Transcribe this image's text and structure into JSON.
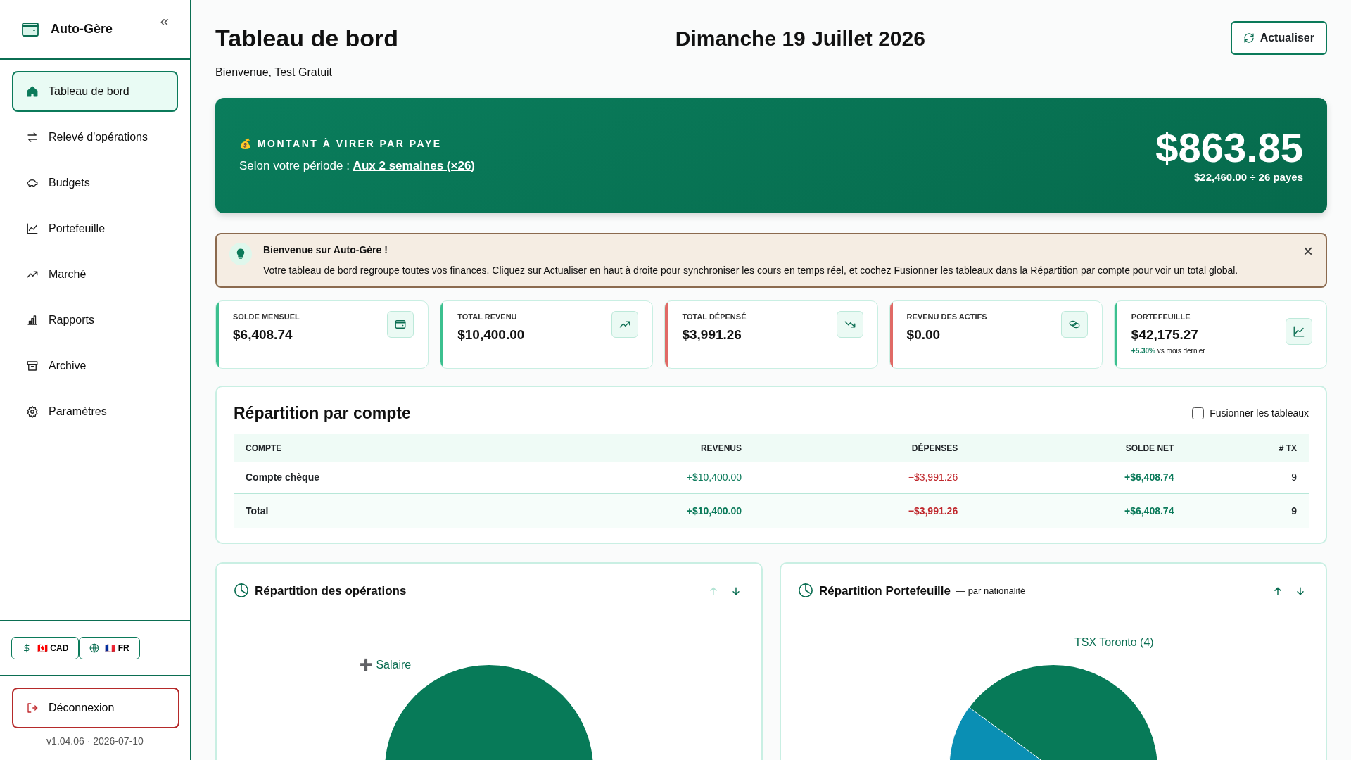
{
  "sidebar": {
    "brand": "Auto-Gère",
    "collapse": "«",
    "items": [
      {
        "label": "Tableau de bord",
        "kind": "home",
        "selected": true
      },
      {
        "label": "Relevé d'opérations",
        "kind": "swap",
        "selected": false
      },
      {
        "label": "Budgets",
        "kind": "piggy",
        "selected": false
      },
      {
        "label": "Portefeuille",
        "kind": "line",
        "selected": false
      },
      {
        "label": "Marché",
        "kind": "trend",
        "selected": false
      },
      {
        "label": "Rapports",
        "kind": "bars",
        "selected": false
      },
      {
        "label": "Archive",
        "kind": "archive",
        "selected": false
      },
      {
        "label": "Paramètres",
        "kind": "gear",
        "selected": false
      }
    ],
    "toggles": [
      {
        "kind": "currency",
        "flag": "🇨🇦",
        "label": "CAD"
      },
      {
        "kind": "language",
        "flag": "🇫🇷",
        "label": "FR"
      }
    ],
    "logout": "Déconnexion",
    "version": "v1.04.06 · 2026-07-10"
  },
  "header": {
    "title": "Tableau de bord",
    "subtitle": "Bienvenue, Test Gratuit",
    "date": "Dimanche 19 Juillet 2026",
    "refresh": "Actualiser"
  },
  "banner": {
    "emoji": "💰",
    "label": "MONTANT À VIRER PAR PAYE",
    "period_prefix": "Selon votre période :",
    "period": "Aux 2 semaines (×26)",
    "amount": "$863.85",
    "detail": "$22,460.00 ÷ 26 payes"
  },
  "alert": {
    "title": "Bienvenue sur Auto-Gère !",
    "text": "Votre tableau de bord regroupe toutes vos finances. Cliquez sur Actualiser en haut à droite pour synchroniser les cours en temps réel, et cochez Fusionner les tableaux dans la Répartition par compte pour voir un total global.",
    "close": "×"
  },
  "stats": [
    {
      "label": "SOLDE MENSUEL",
      "value": "$6,408.74",
      "kind": "wallet",
      "color": "#3cc08f"
    },
    {
      "label": "TOTAL REVENU",
      "value": "$10,400.00",
      "kind": "trend-up",
      "color": "#3cc08f"
    },
    {
      "label": "TOTAL DÉPENSÉ",
      "value": "$3,991.26",
      "kind": "trend-down",
      "color": "#e06a66"
    },
    {
      "label": "REVENU DES ACTIFS",
      "value": "$0.00",
      "kind": "coins",
      "color": "#e06a66"
    },
    {
      "label": "PORTEFEUILLE",
      "value": "$42,175.27",
      "kind": "chart",
      "color": "#3cc08f",
      "change": "+5.30%",
      "change_note": "vs mois dernier"
    }
  ],
  "accounts": {
    "title": "Répartition par compte",
    "merge": {
      "label": "Fusionner les tableaux",
      "checked": false
    },
    "columns": [
      {
        "label": "COMPTE",
        "kind": "plain"
      },
      {
        "label": "REVENUS",
        "kind": "positive"
      },
      {
        "label": "DÉPENSES",
        "kind": "negative"
      },
      {
        "label": "SOLDE NET",
        "kind": "positive"
      },
      {
        "label": "# TX",
        "kind": "plain"
      }
    ],
    "rows": [
      {
        "kind": "row",
        "cells": [
          "Compte chèque",
          "+$10,400.00",
          "−$3,991.26",
          "+$6,408.74",
          "9"
        ]
      },
      {
        "kind": "total",
        "cells": [
          "Total",
          "+$10,400.00",
          "−$3,991.26",
          "+$6,408.74",
          "9"
        ]
      }
    ]
  },
  "charts": [
    {
      "title": "Répartition des opérations",
      "up": {
        "disabled": true
      },
      "down": {
        "disabled": false
      },
      "kind": "full",
      "label": "➕ Salaire"
    },
    {
      "title": "Répartition Portefeuille",
      "subtitle": "— par nationalité",
      "up": {
        "disabled": false
      },
      "down": {
        "disabled": false
      },
      "kind": "split",
      "label": "TSX Toronto (4)"
    }
  ]
}
